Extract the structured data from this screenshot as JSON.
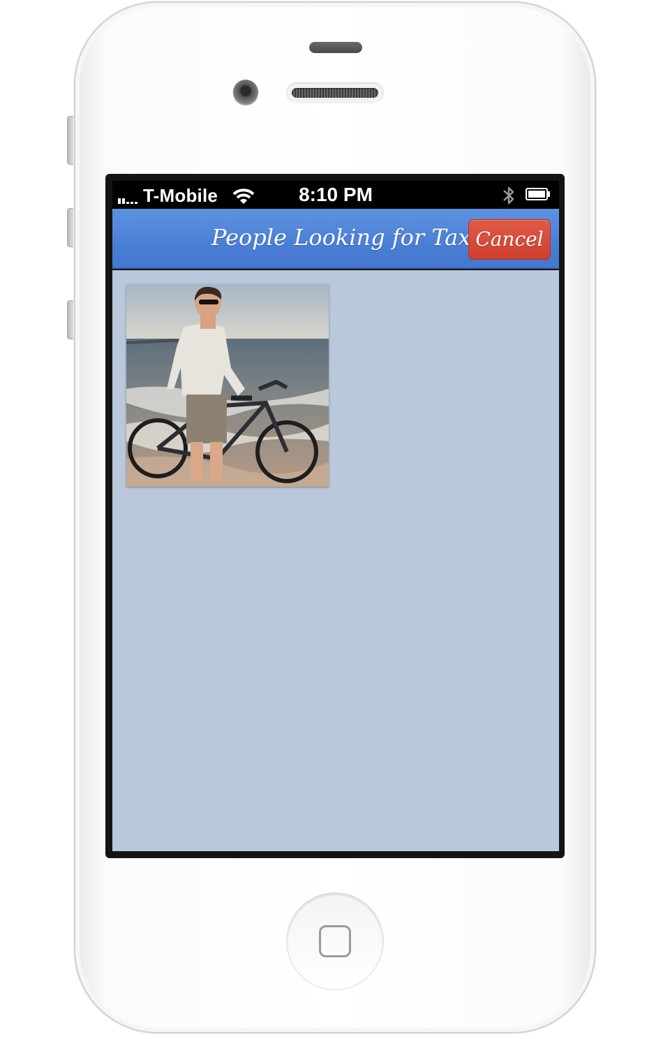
{
  "status_bar": {
    "carrier": "T-Mobile",
    "time": "8:10 PM",
    "icons": [
      "signal-icon",
      "wifi-icon",
      "bluetooth-icon",
      "battery-icon"
    ]
  },
  "nav": {
    "title": "People Looking for Taxis",
    "cancel_label": "Cancel",
    "bar_color": "#4a7fd6",
    "cancel_color": "#d9473a"
  },
  "content": {
    "background_color": "#b9c8db",
    "photos": [
      {
        "subject": "person standing with bicycle in ocean surf"
      }
    ]
  }
}
